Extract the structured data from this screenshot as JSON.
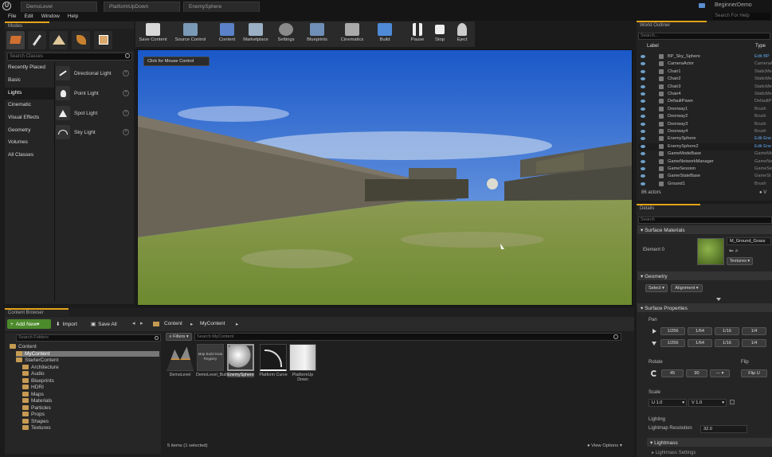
{
  "window": {
    "tabs": [
      "DemoLevel",
      "PlatformUpDown",
      "EnemySphere"
    ],
    "project": "BeginnerDemo",
    "help_search_placeholder": "Search For Help"
  },
  "menu": [
    "File",
    "Edit",
    "Window",
    "Help"
  ],
  "modes": {
    "title": "Modes",
    "search_placeholder": "Search Classes",
    "categories": [
      "Recently Placed",
      "Basic",
      "Lights",
      "Cinematic",
      "Visual Effects",
      "Geometry",
      "Volumes",
      "All Classes"
    ],
    "selected_category": "Lights",
    "lights": [
      "Directional Light",
      "Point Light",
      "Spot Light",
      "Sky Light"
    ]
  },
  "toolbar": [
    "Save Content",
    "Source Control",
    "Content",
    "Marketplace",
    "Settings",
    "Blueprints",
    "Cinematics",
    "Build",
    "Pause",
    "Stop",
    "Eject"
  ],
  "viewport": {
    "badge": "Click for Mouse Control"
  },
  "outliner": {
    "title": "World Outliner",
    "search_placeholder": "Search...",
    "col_label": "Label",
    "col_type": "Type",
    "rows": [
      {
        "label": "BP_Sky_Sphere",
        "type": "Edit BP"
      },
      {
        "label": "CameraActor",
        "type": "CameraA"
      },
      {
        "label": "Chair1",
        "type": "StaticMe"
      },
      {
        "label": "Chair2",
        "type": "StaticMe"
      },
      {
        "label": "Chair3",
        "type": "StaticMe"
      },
      {
        "label": "Chair4",
        "type": "StaticMe"
      },
      {
        "label": "DefaultPawn",
        "type": "DefaultP"
      },
      {
        "label": "Doorway1",
        "type": "Brush"
      },
      {
        "label": "Doorway2",
        "type": "Brush"
      },
      {
        "label": "Doorway3",
        "type": "Brush"
      },
      {
        "label": "Doorway4",
        "type": "Brush"
      },
      {
        "label": "EnemySphere",
        "type": "Edit Ene"
      },
      {
        "label": "EnemySphere2",
        "type": "Edit Ene"
      },
      {
        "label": "GameModeBase",
        "type": "GameMo"
      },
      {
        "label": "GameNetworkManager",
        "type": "GameNe"
      },
      {
        "label": "GameSession",
        "type": "GameSe"
      },
      {
        "label": "GameStateBase",
        "type": "GameSt"
      },
      {
        "label": "Ground1",
        "type": "Brush"
      }
    ],
    "actor_count": "86 actors",
    "view_label": "V"
  },
  "details": {
    "title": "Details",
    "search_placeholder": "Search",
    "surface_materials": "Surface Materials",
    "element_label": "Element 0",
    "material_name": "M_Ground_Grass",
    "textures_btn": "Textures",
    "geometry": "Geometry",
    "select_btn": "Select",
    "alignment_btn": "Alignment",
    "surface_properties": "Surface Properties",
    "pan_label": "Pan",
    "pan_values": [
      "1/256",
      "1/64",
      "1/16",
      "1/4"
    ],
    "rotate_label": "Rotate",
    "rotate_values": [
      "45",
      "90",
      "---"
    ],
    "flip_label": "Flip",
    "flip_btn": "Flip U",
    "scale_label": "Scale",
    "scale_u": "U 1.0",
    "scale_v": "V 1.0",
    "lighting_label": "Lighting",
    "lightmap_label": "Lightmap Resolution",
    "lightmap_value": "32.0",
    "lightmass": "Lightmass",
    "lightmass_settings": "Lightmass Settings"
  },
  "content_browser": {
    "title": "Content Browser",
    "add_new": "Add New",
    "import": "Import",
    "save_all": "Save All",
    "path": [
      "Content",
      "MyContent"
    ],
    "search_folders_placeholder": "Search Folders",
    "filters": "Filters",
    "search_placeholder": "Search MyContent",
    "tree": [
      {
        "name": "Content",
        "depth": 0
      },
      {
        "name": "MyContent",
        "depth": 1
      },
      {
        "name": "StarterContent",
        "depth": 1
      },
      {
        "name": "Architecture",
        "depth": 2
      },
      {
        "name": "Audio",
        "depth": 2
      },
      {
        "name": "Blueprints",
        "depth": 2
      },
      {
        "name": "HDRI",
        "depth": 2
      },
      {
        "name": "Maps",
        "depth": 2
      },
      {
        "name": "Materials",
        "depth": 2
      },
      {
        "name": "Particles",
        "depth": 2
      },
      {
        "name": "Props",
        "depth": 2
      },
      {
        "name": "Shapes",
        "depth": 2
      },
      {
        "name": "Textures",
        "depth": 2
      }
    ],
    "assets": [
      "DemoLevel",
      "DemoLevel_BuiltData",
      "EnemySphere",
      "Platform Curve",
      "PlatformUp Down"
    ],
    "map_registry_label": "Map Build Data Registry",
    "status": "5 items (1 selected)",
    "view_options": "View Options"
  }
}
